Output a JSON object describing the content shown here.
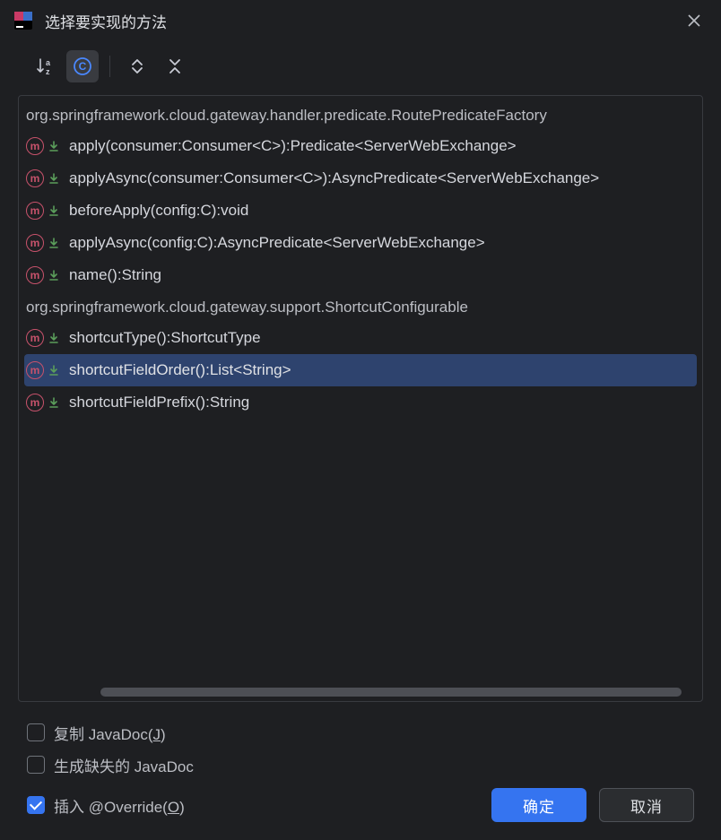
{
  "title": "选择要实现的方法",
  "toolbar": {
    "sort_az": "sort-az",
    "class_filter": "class-filter-c",
    "expand": "expand",
    "collapse": "collapse"
  },
  "groups": [
    {
      "header": "org.springframework.cloud.gateway.handler.predicate.RoutePredicateFactory",
      "items": [
        {
          "label": "apply(consumer:Consumer<C>):Predicate<ServerWebExchange>",
          "selected": false
        },
        {
          "label": "applyAsync(consumer:Consumer<C>):AsyncPredicate<ServerWebExchange>",
          "selected": false
        },
        {
          "label": "beforeApply(config:C):void",
          "selected": false
        },
        {
          "label": "applyAsync(config:C):AsyncPredicate<ServerWebExchange>",
          "selected": false
        },
        {
          "label": "name():String",
          "selected": false
        }
      ]
    },
    {
      "header": "org.springframework.cloud.gateway.support.ShortcutConfigurable",
      "items": [
        {
          "label": "shortcutType():ShortcutType",
          "selected": false
        },
        {
          "label": "shortcutFieldOrder():List<String>",
          "selected": true
        },
        {
          "label": "shortcutFieldPrefix():String",
          "selected": false
        }
      ]
    }
  ],
  "scroll": {
    "left_pct": 12,
    "width_pct": 85
  },
  "checkboxes": {
    "copy_javadoc": {
      "label": "复制 JavaDoc(",
      "mnemonic": "J",
      "suffix": ")",
      "checked": false
    },
    "gen_missing_javadoc": {
      "label": "生成缺失的 JavaDoc",
      "checked": false
    },
    "insert_override": {
      "label": "插入 @Override(",
      "mnemonic": "O",
      "suffix": ")",
      "checked": true
    }
  },
  "buttons": {
    "ok": "确定",
    "cancel": "取消"
  }
}
